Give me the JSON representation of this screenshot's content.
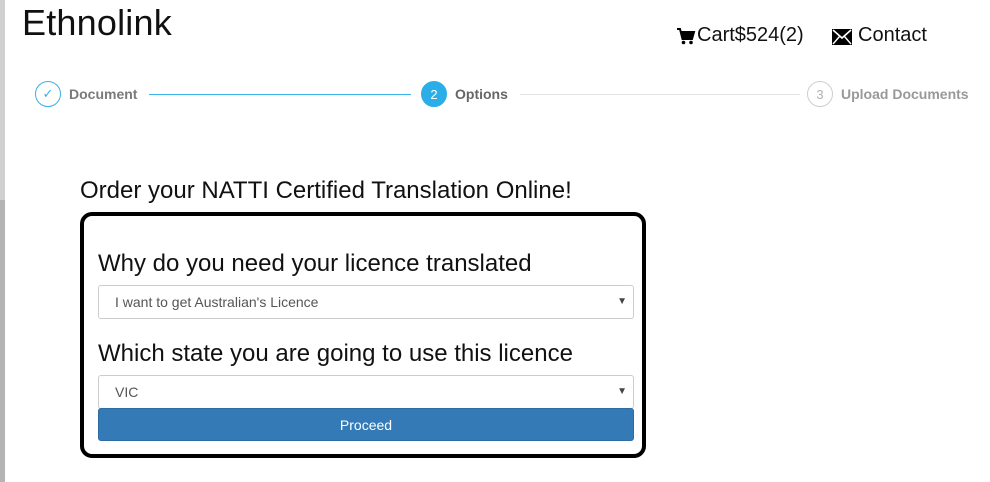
{
  "brand": {
    "name": "Ethnolink"
  },
  "header": {
    "cart_label": "Cart$524(2)",
    "contact_label": "Contact",
    "icons": {
      "cart": "shopping-cart-icon",
      "contact": "envelope-icon"
    }
  },
  "stepper": {
    "steps": [
      {
        "number": "✓",
        "label": "Document",
        "state": "completed"
      },
      {
        "number": "2",
        "label": "Options",
        "state": "active"
      },
      {
        "number": "3",
        "label": "Upload Documents",
        "state": "pending"
      }
    ]
  },
  "main": {
    "title": "Order your NATTI Certified Translation Online!",
    "question_reason": "Why do you need your licence translated",
    "reason_selected": "I want to get Australian's Licence",
    "question_state": "Which state you are going to use this licence",
    "state_selected": "VIC",
    "proceed_label": "Proceed"
  },
  "colors": {
    "accent": "#2baee8",
    "button": "#337ab7",
    "form_border": "#000000"
  }
}
